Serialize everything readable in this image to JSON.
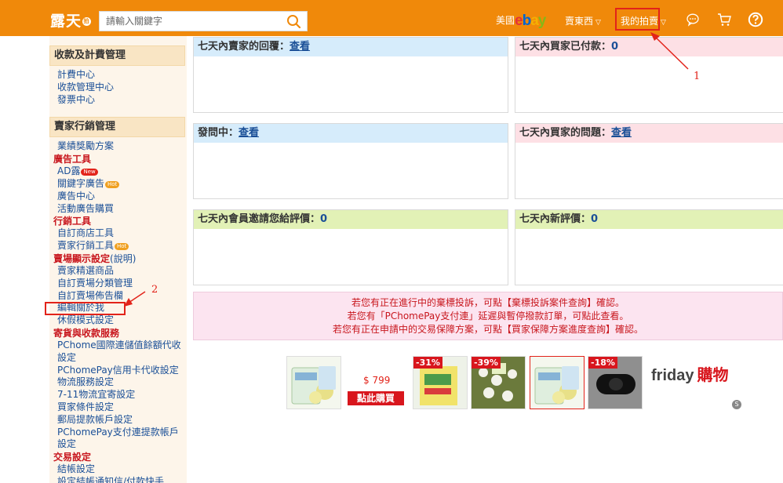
{
  "topbar": {
    "logo": "露天",
    "logo_badge": "拍",
    "search_placeholder": "請輸入關鍵字",
    "ebay_prefix": "美國",
    "ebay_brand": {
      "e": "e",
      "b": "b",
      "a": "a",
      "y": "y"
    },
    "sell_label": "賣東西",
    "my_auction_label": "我的拍賣",
    "chat_icon": "chat-bubble-icon",
    "cart_icon": "cart-icon",
    "help_icon": "question-circle-icon"
  },
  "sidebar": {
    "sections": {
      "billing": {
        "title": "收款及計費管理",
        "links": [
          "計費中心",
          "收款管理中心",
          "發票中心"
        ]
      },
      "marketing": {
        "title": "賣家行銷管理",
        "top_link": "業績獎勵方案",
        "ad_tools": "廣告工具",
        "ad_links": [
          "AD露",
          "關鍵字廣告",
          "廣告中心",
          "活動廣告購買"
        ],
        "marketing_tools": "行銷工具",
        "marketing_links": [
          "自訂商店工具",
          "賣家行銷工具"
        ],
        "display_settings": "賣場顯示設定",
        "display_note": "(說明)",
        "display_links": [
          "賣家精選商品",
          "自訂賣場分類管理",
          "自訂賣場佈告欄",
          "編輯關於我",
          "休假模式設定"
        ],
        "shipping": "寄貨與收款服務",
        "shipping_links": [
          "PChome國際連儲值餘額代收設定",
          "PChomePay信用卡代收設定",
          "物流服務設定",
          "7-11物流宜寄設定",
          "買家條件設定",
          "郵局提款帳戶設定",
          "PChomePay支付連提款帳戶設定"
        ],
        "trade": "交易設定",
        "trade_links": [
          "結帳設定",
          "設定結帳通知信/付款快手"
        ]
      }
    },
    "badges": {
      "new": "New",
      "hot": "Hot"
    }
  },
  "panels": [
    {
      "title": "七天內賣家的回覆：",
      "link": "查看",
      "color": "blue"
    },
    {
      "title": "七天內買家已付款：",
      "value": "0",
      "color": "pink"
    },
    {
      "title": "發問中：",
      "link": "查看",
      "color": "blue"
    },
    {
      "title": "七天內買家的問題：",
      "link": "查看",
      "color": "pink"
    },
    {
      "title": "七天內會員邀請您給評價：",
      "value": "0",
      "color": "green"
    },
    {
      "title": "七天內新評價：",
      "value": "0",
      "color": "green"
    }
  ],
  "notice": {
    "lines": [
      "若您有正在進行中的棄標投訴，可點【棄標投訴案件查詢】確認。",
      "若您有「PChomePay支付連」延遲與暫停撥款訂單，可點此查看。",
      "若您有正在申請中的交易保障方案，可點【買家保障方案進度查詢】確認。"
    ]
  },
  "ads": {
    "price": "$ 799",
    "buy_label": "點此購買",
    "discounts": [
      "-31%",
      "-39%",
      "-18%"
    ],
    "friday_logo": "friday",
    "friday_cn": "購物",
    "slide_indicator": "S"
  },
  "annotations": {
    "one": "1",
    "two": "2"
  },
  "colors": {
    "brand_orange": "#f0890a",
    "link_blue": "#1a4f97",
    "alert_red": "#c8161d"
  }
}
